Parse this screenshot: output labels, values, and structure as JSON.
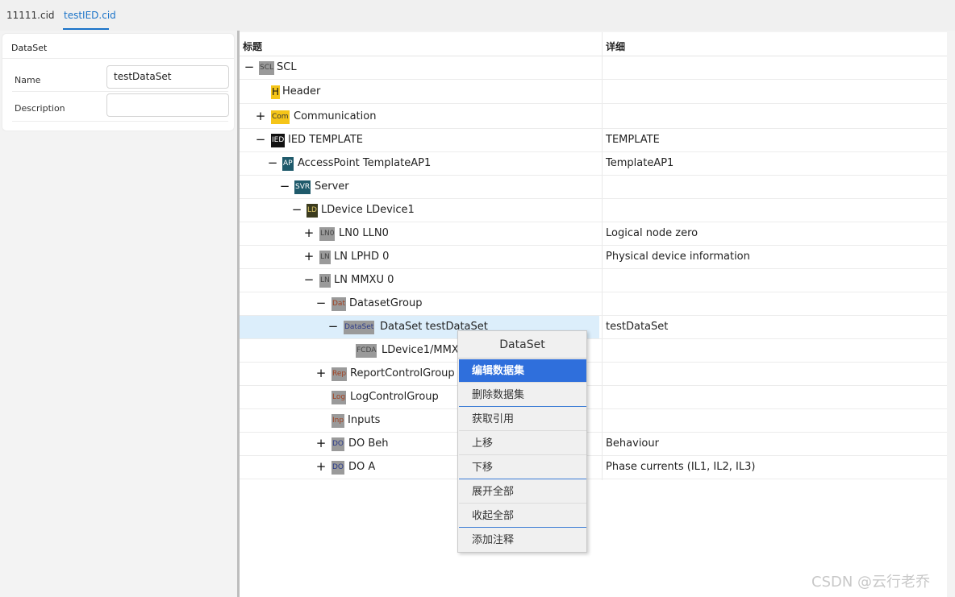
{
  "tabs": [
    {
      "label": "11111.cid"
    },
    {
      "label": "testIED.cid"
    }
  ],
  "dataset_panel": {
    "title": "DataSet",
    "name_label": "Name",
    "name_value": "testDataSet",
    "description_label": "Description",
    "description_value": ""
  },
  "grid": {
    "col_title": "标题",
    "col_detail": "详细",
    "rows": [
      {
        "toggle": "−",
        "badge": "SCL",
        "label": "SCL",
        "detail": ""
      },
      {
        "toggle": "",
        "badge": "H",
        "label": "Header",
        "detail": ""
      },
      {
        "toggle": "+",
        "badge": "Com",
        "label": "Communication",
        "detail": ""
      },
      {
        "toggle": "−",
        "badge": "IED",
        "label": "IED TEMPLATE",
        "detail": "TEMPLATE"
      },
      {
        "toggle": "−",
        "badge": "AP",
        "label": "AccessPoint TemplateAP1",
        "detail": "TemplateAP1"
      },
      {
        "toggle": "−",
        "badge": "SVR",
        "label": "Server",
        "detail": ""
      },
      {
        "toggle": "−",
        "badge": "LD",
        "label": "LDevice LDevice1",
        "detail": ""
      },
      {
        "toggle": "+",
        "badge": "LN0",
        "label": "LN0 LLN0",
        "detail": "Logical node zero"
      },
      {
        "toggle": "+",
        "badge": "LN",
        "label": "LN LPHD 0",
        "detail": "Physical device information"
      },
      {
        "toggle": "−",
        "badge": "LN",
        "label": "LN MMXU 0",
        "detail": ""
      },
      {
        "toggle": "−",
        "badge": "Dat",
        "label": "DatasetGroup",
        "detail": ""
      },
      {
        "toggle": "−",
        "badge": "DataSet",
        "label": "DataSet testDataSet",
        "detail": "testDataSet"
      },
      {
        "toggle": "",
        "badge": "FCDA",
        "label": "LDevice1/MMX",
        "detail": ""
      },
      {
        "toggle": "+",
        "badge": "Rep",
        "label": "ReportControlGroup",
        "detail": ""
      },
      {
        "toggle": "",
        "badge": "Log",
        "label": "LogControlGroup",
        "detail": ""
      },
      {
        "toggle": "",
        "badge": "Inp",
        "label": "Inputs",
        "detail": ""
      },
      {
        "toggle": "+",
        "badge": "DO",
        "label": "DO Beh",
        "detail": "Behaviour"
      },
      {
        "toggle": "+",
        "badge": "DO",
        "label": "DO A",
        "detail": "Phase currents (IL1, IL2, IL3)"
      }
    ]
  },
  "context_menu": {
    "title": "DataSet",
    "items": [
      {
        "label": "编辑数据集"
      },
      {
        "label": "删除数据集"
      },
      {
        "label": "获取引用"
      },
      {
        "label": "上移"
      },
      {
        "label": "下移"
      },
      {
        "label": "展开全部"
      },
      {
        "label": "收起全部"
      },
      {
        "label": "添加注释"
      }
    ]
  },
  "watermark": "CSDN @云行老乔",
  "colors": {
    "accent": "#1a73c8",
    "menu_highlight": "#2f6fdc",
    "selected_row": "#dceefb"
  }
}
